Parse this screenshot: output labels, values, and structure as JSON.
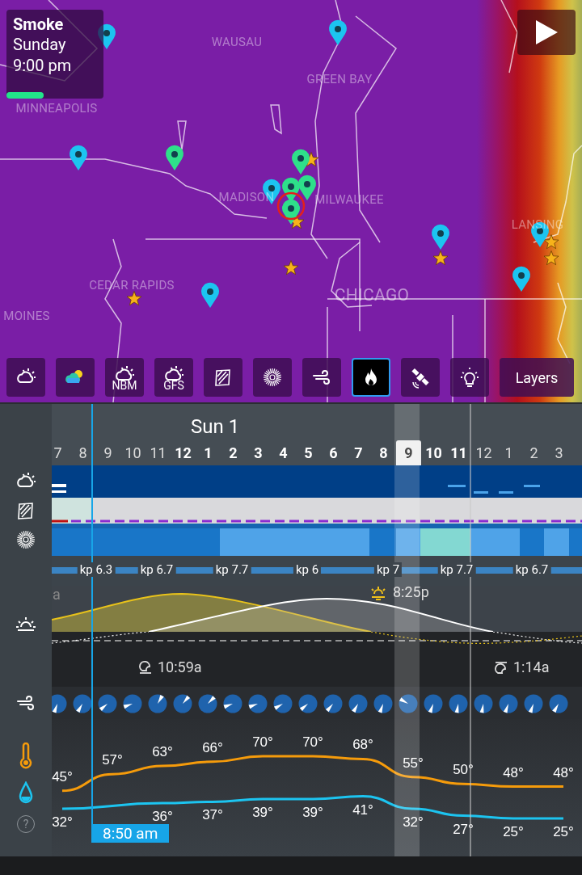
{
  "map": {
    "labels": [
      "MINNEAPOLIS",
      "WAUSAU",
      "GREEN BAY",
      "MADISON",
      "MILWAUKEE",
      "CEDAR RAPIDS",
      "MOINES",
      "CHICAGO",
      "LANSING"
    ],
    "layer_card": {
      "title": "Smoke",
      "day": "Sunday",
      "time": "9:00 pm",
      "level": 0.38
    },
    "toolbar": [
      {
        "kind": "cloud",
        "selected": false
      },
      {
        "kind": "color-cloud",
        "selected": false
      },
      {
        "kind": "cloud",
        "label": "NBM",
        "selected": false
      },
      {
        "kind": "cloud",
        "label": "GFS",
        "selected": false
      },
      {
        "kind": "hatch",
        "selected": false
      },
      {
        "kind": "radial",
        "selected": false
      },
      {
        "kind": "wind",
        "selected": false
      },
      {
        "kind": "flame",
        "selected": true
      },
      {
        "kind": "satellite",
        "selected": false
      },
      {
        "kind": "bulb",
        "selected": false
      },
      {
        "kind": "text",
        "label": "Layers",
        "selected": false
      }
    ]
  },
  "timeline": {
    "date": "Sun 1",
    "hours": [
      {
        "label": "7",
        "daytime": false,
        "selected": false
      },
      {
        "label": "8",
        "daytime": false,
        "selected": false
      },
      {
        "label": "9",
        "daytime": false,
        "selected": false
      },
      {
        "label": "10",
        "daytime": false,
        "selected": false
      },
      {
        "label": "11",
        "daytime": false,
        "selected": false
      },
      {
        "label": "12",
        "daytime": true,
        "selected": false
      },
      {
        "label": "1",
        "daytime": true,
        "selected": false
      },
      {
        "label": "2",
        "daytime": true,
        "selected": false
      },
      {
        "label": "3",
        "daytime": true,
        "selected": false
      },
      {
        "label": "4",
        "daytime": true,
        "selected": false
      },
      {
        "label": "5",
        "daytime": true,
        "selected": false
      },
      {
        "label": "6",
        "daytime": true,
        "selected": false
      },
      {
        "label": "7",
        "daytime": true,
        "selected": false
      },
      {
        "label": "8",
        "daytime": true,
        "selected": false
      },
      {
        "label": "9",
        "daytime": true,
        "selected": true
      },
      {
        "label": "10",
        "daytime": true,
        "selected": false
      },
      {
        "label": "11",
        "daytime": true,
        "selected": false
      },
      {
        "label": "12",
        "daytime": false,
        "selected": false
      },
      {
        "label": "1",
        "daytime": false,
        "selected": false
      },
      {
        "label": "2",
        "daytime": false,
        "selected": false
      },
      {
        "label": "3",
        "daytime": false,
        "selected": false
      }
    ],
    "kp": [
      "kp 6.3",
      "kp 6.7",
      "kp 7.7",
      "kp 6",
      "kp 7",
      "kp 7.7",
      "kp 6.7"
    ],
    "sun": {
      "cut_label": "a",
      "sunset": "8:25p"
    },
    "moon": {
      "rise": "10:59a",
      "set": "1:14a"
    },
    "cursor": "8:50 am",
    "help": "?",
    "chart_data": {
      "type": "line",
      "data_labels": true,
      "series": [
        {
          "color": "#f59b0b",
          "values": [
            45,
            57,
            63,
            66,
            70,
            70,
            68,
            55,
            50,
            48,
            48
          ],
          "value_labels": [
            "45°",
            "57°",
            "63°",
            "66°",
            "70°",
            "70°",
            "68°",
            "55°",
            "50°",
            "48°",
            "48°"
          ]
        },
        {
          "color": "#1cc4f0",
          "values": [
            32,
            null,
            36,
            37,
            39,
            39,
            41,
            32,
            27,
            25,
            25
          ],
          "value_labels": [
            "32°",
            null,
            "36°",
            "37°",
            "39°",
            "39°",
            "41°",
            "32°",
            "27°",
            "25°",
            "25°"
          ]
        }
      ]
    }
  }
}
